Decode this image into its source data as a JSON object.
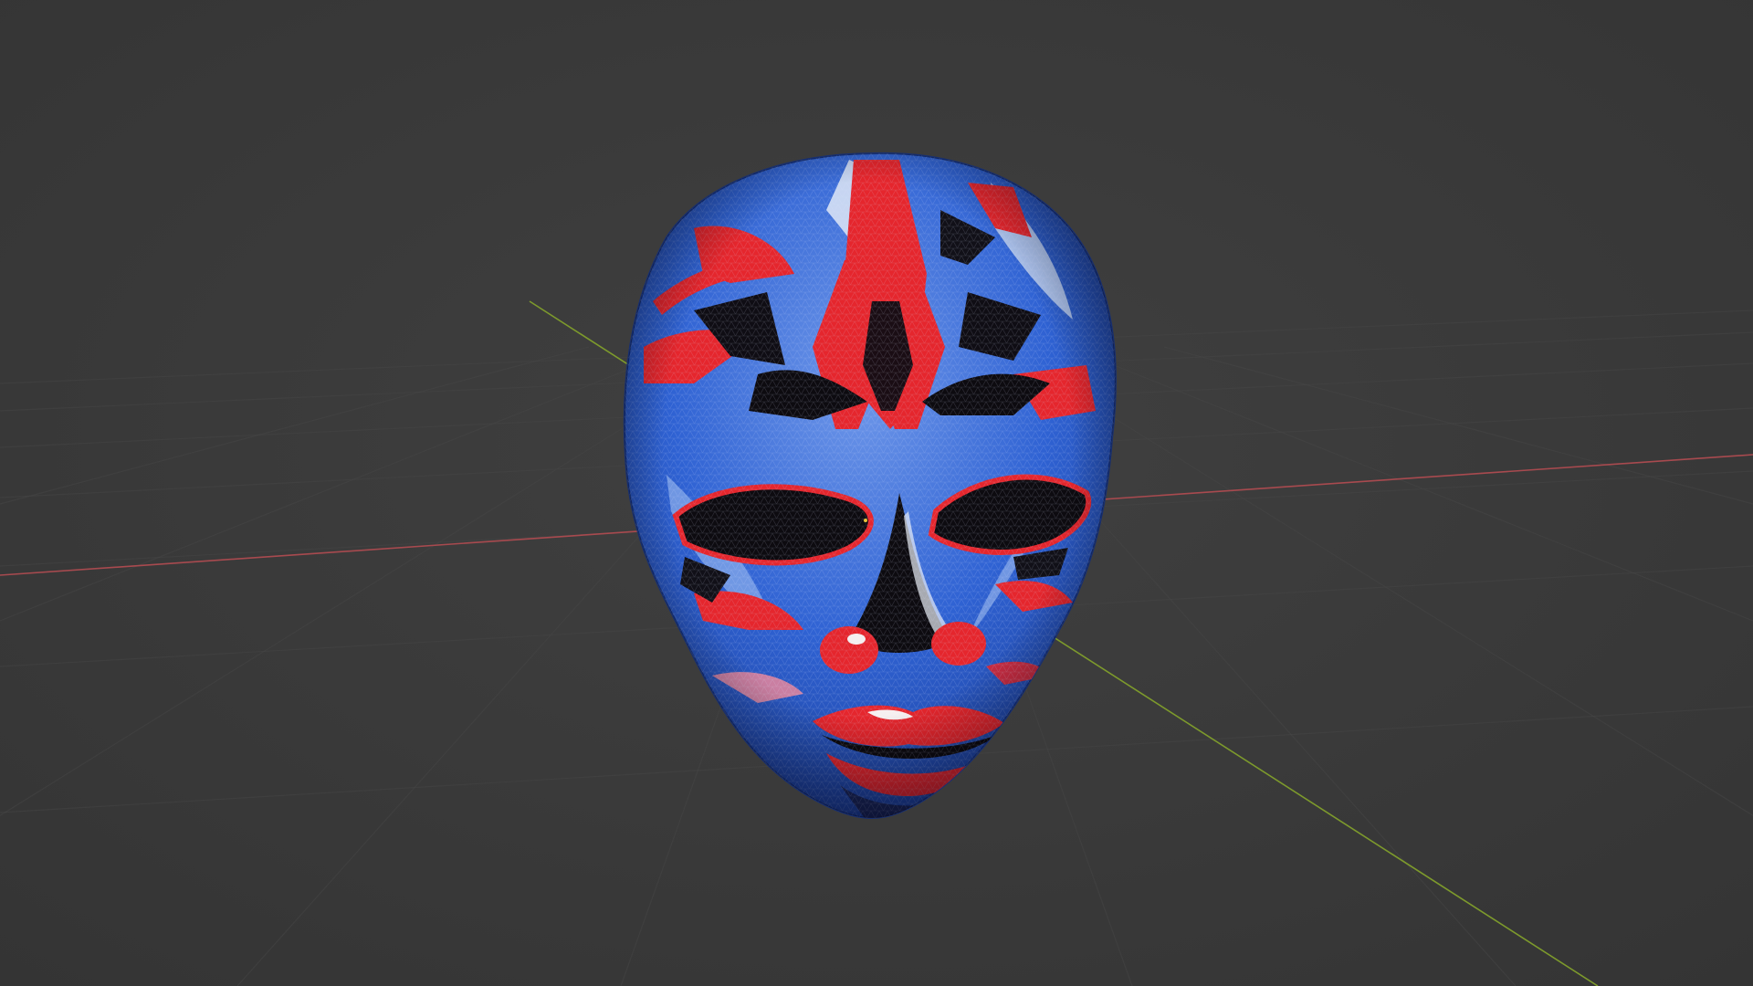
{
  "viewport": {
    "kind": "3d-viewport",
    "background_color": "#3b3b3b",
    "grid_line_color": "#464646",
    "x_axis_color": "#a84a4f",
    "y_axis_color": "#7d9a2c",
    "grid_visible": true
  },
  "model": {
    "kind": "textured-mesh",
    "subject": "painted mask",
    "wireframe_overlay": true,
    "palette": {
      "base_blue": "#2e63d6",
      "light_blue": "#8fb3ee",
      "red": "#e5262d",
      "pink": "#f28a9a",
      "black": "#0d0b10",
      "white": "#e9eef6"
    }
  }
}
